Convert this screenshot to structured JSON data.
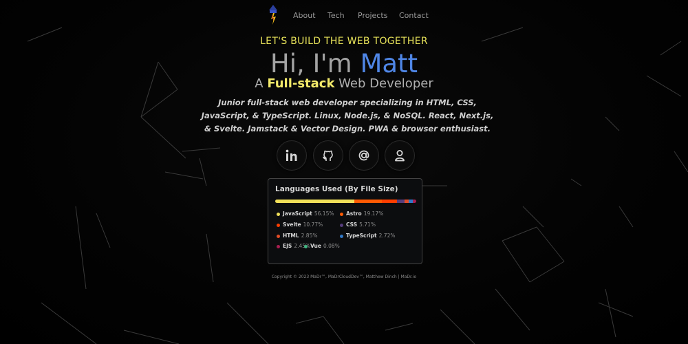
{
  "nav": {
    "links": [
      "About",
      "Tech",
      "Projects",
      "Contact"
    ]
  },
  "hero": {
    "tagline": "LET'S BUILD THE WEB TOGETHER",
    "greeting": "Hi, I'm ",
    "name": "Matt",
    "role_prefix": "A ",
    "role_highlight": "Full-stack",
    "role_suffix": " Web Developer",
    "bio": "Junior full-stack web developer specializing in HTML, CSS, JavaScript, & TypeScript. Linux, Node.js, & NoSQL. React, Next.js, & Svelte. Jamstack & Vector Design. PWA & browser enthusiast."
  },
  "social": [
    "linkedin-icon",
    "github-icon",
    "at-sign-icon",
    "user-icon"
  ],
  "languages": {
    "title": "Languages Used (By File Size)",
    "items": [
      {
        "name": "JavaScript",
        "percent": "56.15%",
        "value": 56.15,
        "color": "#f1e05a"
      },
      {
        "name": "Astro",
        "percent": "19.17%",
        "value": 19.17,
        "color": "#ff5a03"
      },
      {
        "name": "Svelte",
        "percent": "10.77%",
        "value": 10.77,
        "color": "#ff3e00"
      },
      {
        "name": "CSS",
        "percent": "5.71%",
        "value": 5.71,
        "color": "#563d7c"
      },
      {
        "name": "HTML",
        "percent": "2.85%",
        "value": 2.85,
        "color": "#e34c26"
      },
      {
        "name": "TypeScript",
        "percent": "2.72%",
        "value": 2.72,
        "color": "#3178c6"
      },
      {
        "name": "EJS",
        "percent": "2.45%",
        "value": 2.45,
        "color": "#a91e50"
      },
      {
        "name": "Vue",
        "percent": "0.08%",
        "value": 0.08,
        "color": "#41b883"
      }
    ]
  },
  "footer": {
    "copyright": "Copyright © 2023 MaDr™, MaDrCloudDev™, Matthew Dinch | MaDr.io"
  },
  "colors": {
    "accent_yellow": "#e8e35a",
    "accent_blue": "#4f86e6",
    "background": "#020202"
  }
}
